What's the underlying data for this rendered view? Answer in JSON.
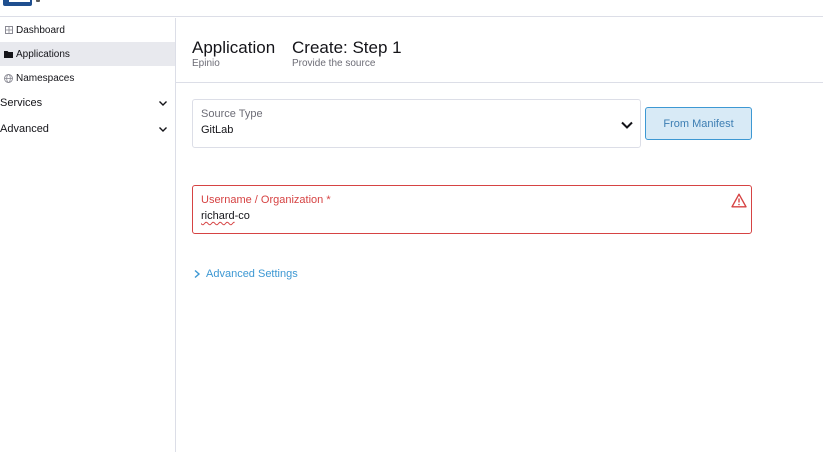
{
  "sidebar": {
    "items": [
      {
        "label": "Dashboard",
        "icon": "dashboard-icon"
      },
      {
        "label": "Applications",
        "icon": "folder-icon"
      },
      {
        "label": "Namespaces",
        "icon": "globe-icon"
      }
    ],
    "groups": [
      {
        "label": "Services",
        "icon": "chevron-down-icon"
      },
      {
        "label": "Advanced",
        "icon": "chevron-down-icon"
      }
    ]
  },
  "header": {
    "title": "Application",
    "subtitle": "Epinio",
    "step_title": "Create: Step 1",
    "step_subtitle": "Provide the source"
  },
  "form": {
    "source_type": {
      "label": "Source Type",
      "value": "GitLab"
    },
    "from_manifest_label": "From Manifest",
    "username": {
      "label": "Username / Organization *",
      "value_part1": "richard",
      "value_part2": "-co"
    },
    "advanced_settings_label": "Advanced Settings"
  },
  "colors": {
    "accent": "#3d98d3",
    "error": "#d64343",
    "active_nav_bg": "#e8e9ee"
  }
}
